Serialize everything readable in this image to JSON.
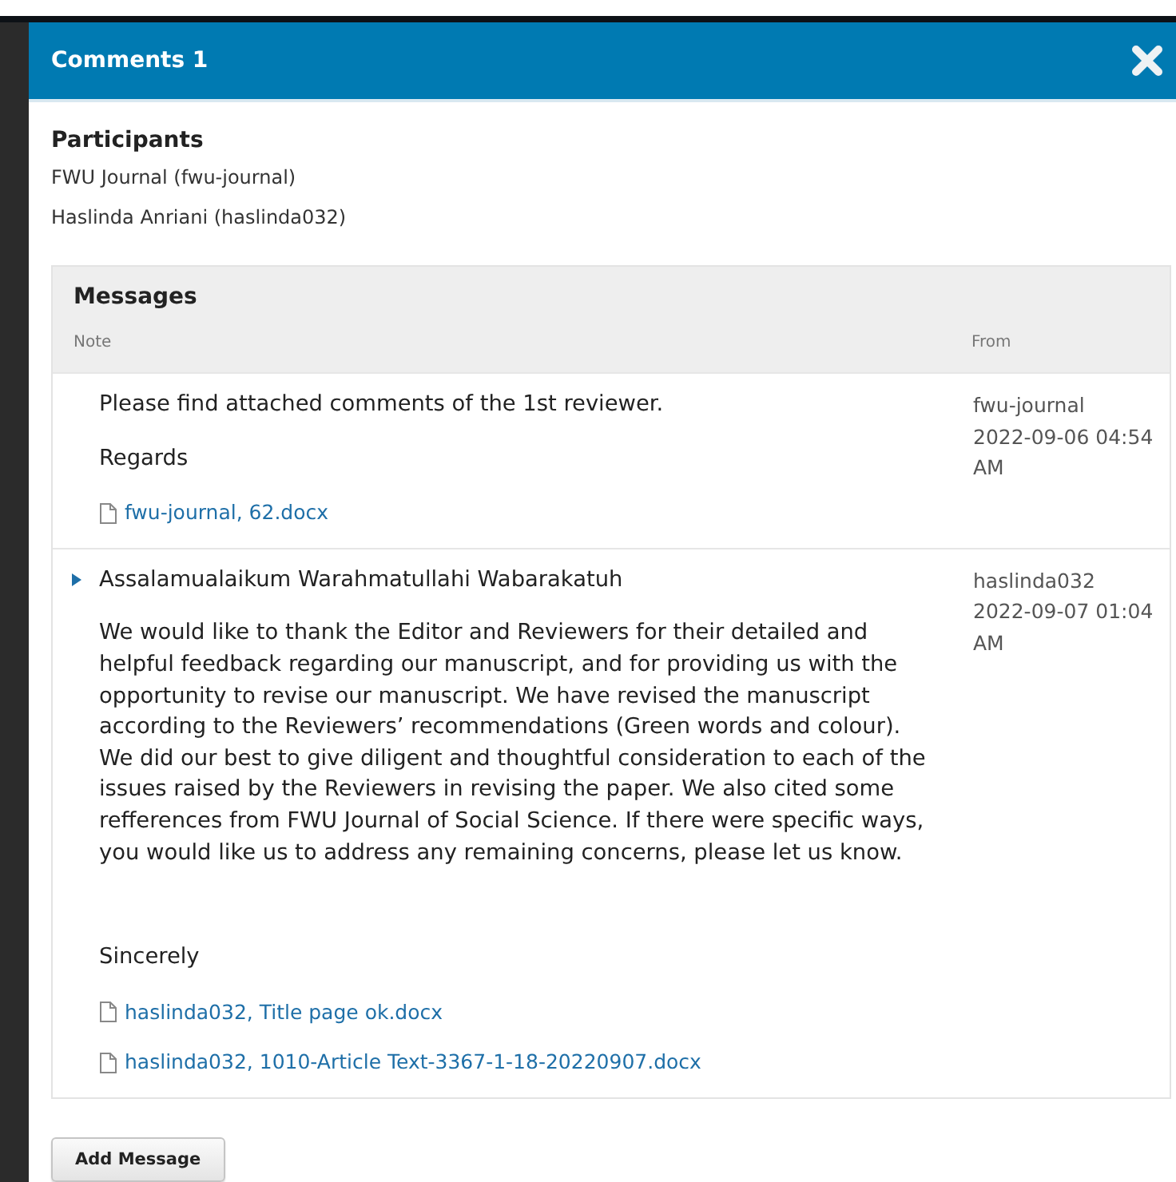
{
  "modal": {
    "title": "Comments 1"
  },
  "participants": {
    "heading": "Participants",
    "people": [
      "FWU Journal (fwu-journal)",
      "Haslinda Anriani (haslinda032)"
    ]
  },
  "messages": {
    "heading": "Messages",
    "columns": [
      "Note",
      "From"
    ],
    "rows": [
      {
        "expandable": false,
        "paragraphs": [
          "Please find attached comments of the 1st reviewer."
        ],
        "closing": "Regards",
        "closing_spaced": false,
        "attachments": [
          "fwu-journal, 62.docx"
        ],
        "from": "fwu-journal",
        "date": "2022-09-06 04:54 AM"
      },
      {
        "expandable": true,
        "paragraphs": [
          "Assalamualaikum Warahmatullahi Wabarakatuh",
          "We would like to thank the Editor and Reviewers for their detailed and helpful feedback regarding our manuscript, and for providing us with the opportunity to revise our manuscript. We have revised the manuscript according to the Reviewers’ recommendations (Green words and colour). We did our best to give diligent and thoughtful consideration to each of the issues raised by the Reviewers in revising the paper. We also cited some refferences from FWU Journal of Social Science. If there were specific ways, you would like us to address any remaining concerns, please let us know."
        ],
        "closing": "Sincerely",
        "closing_spaced": true,
        "attachments": [
          "haslinda032, Title page ok.docx",
          "haslinda032, 1010-Article Text-3367-1-18-20220907.docx"
        ],
        "from": "haslinda032",
        "date": "2022-09-07 01:04 AM"
      }
    ]
  },
  "add_button": "Add Message"
}
